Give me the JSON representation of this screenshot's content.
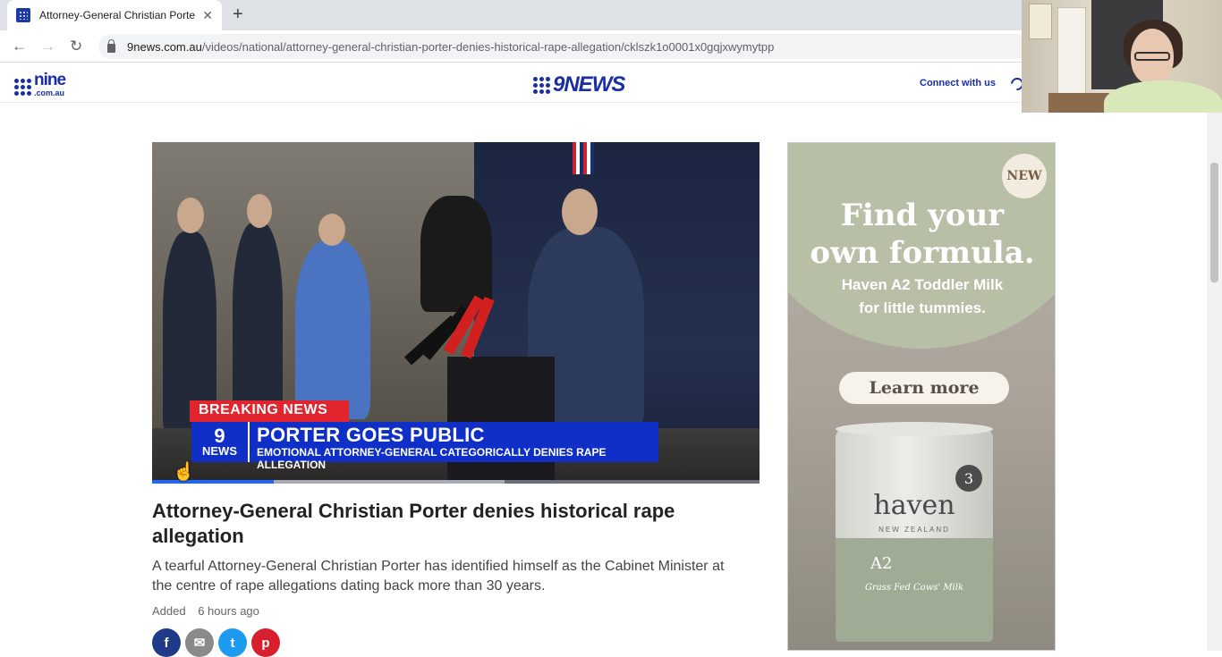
{
  "browser": {
    "tab_title": "Attorney-General Christian Porter denies historical rape allegation",
    "tab_close": "✕",
    "new_tab": "+",
    "back": "←",
    "forward": "→",
    "reload": "↻",
    "url_host": "9news.com.au",
    "url_path": "/videos/national/attorney-general-christian-porter-denies-historical-rape-allegation/cklszk1o0001x0gqjxwymytpp"
  },
  "header": {
    "nine_logo_text": "nine",
    "nine_logo_sub": ".com.au",
    "news_logo_text": "9NEWS",
    "connect_label": "Connect with us"
  },
  "video": {
    "breaking_label": "BREAKING NEWS",
    "logo_nine": "9",
    "logo_news": "NEWS",
    "headline": "PORTER GOES PUBLIC",
    "subline": "EMOTIONAL ATTORNEY-GENERAL CATEGORICALLY DENIES RAPE ALLEGATION",
    "progress_fraction": 0.2,
    "buffer_fraction": 0.58
  },
  "article": {
    "title": "Attorney-General Christian Porter denies historical rape allegation",
    "description": "A tearful Attorney-General Christian Porter has identified himself as the Cabinet Minister at the centre of rape allegations dating back more than 30 years.",
    "added_label": "Added",
    "added_time": "6 hours ago",
    "share": {
      "facebook": "f",
      "email": "✉",
      "twitter": "t",
      "pinterest": "p"
    }
  },
  "ad": {
    "badge": "NEW",
    "headline_line1": "Find your",
    "headline_line2": "own formula.",
    "sub_line1": "Haven A2 Toddler Milk",
    "sub_line2": "for little tummies.",
    "cta": "Learn more",
    "brand": "haven",
    "brand_sub": "NEW ZEALAND",
    "tin_number": "3",
    "tin_a2": "A2",
    "tin_grass": "Grass Fed Cows' Milk"
  },
  "colors": {
    "brand_blue": "#1a2fa5",
    "breaking_red": "#e2242f",
    "progress_blue": "#1e66ff"
  }
}
